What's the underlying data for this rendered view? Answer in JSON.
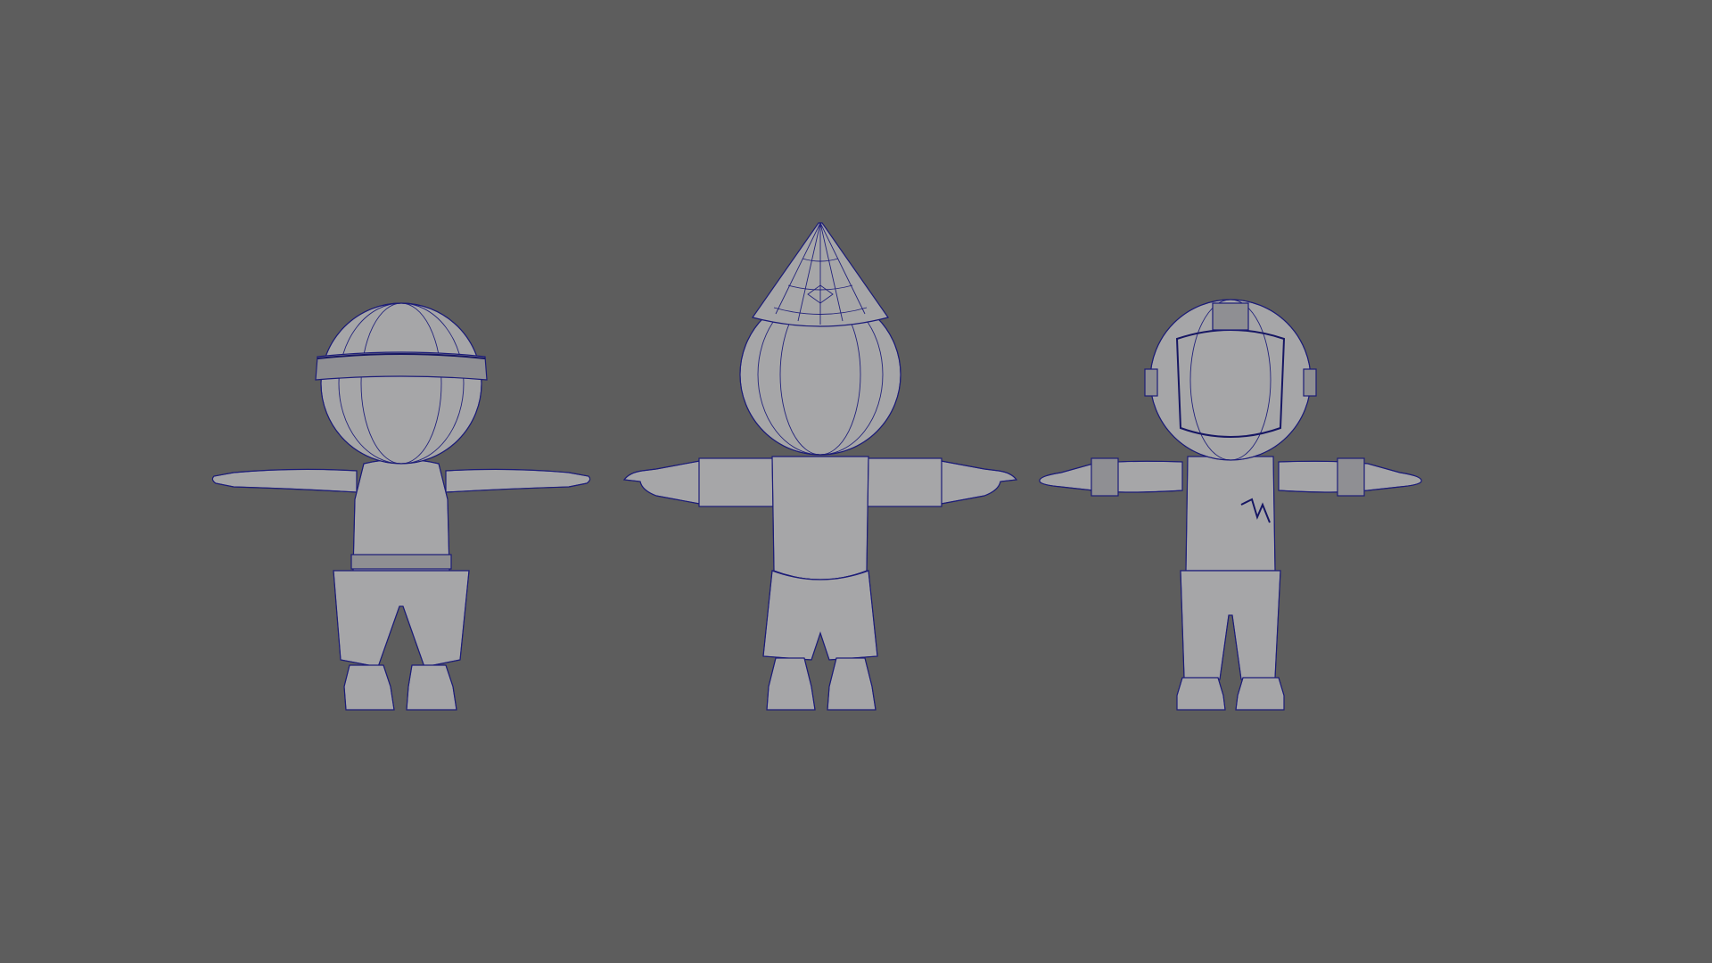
{
  "viewport": {
    "background_color": "#5d5d5d",
    "mesh_fill_color": "#a6a6a8",
    "wireframe_color": "#1c1c78"
  },
  "scene": {
    "models": [
      {
        "name": "character-headband",
        "accessory": "headband"
      },
      {
        "name": "character-cone-hat",
        "accessory": "cone-hat"
      },
      {
        "name": "character-helmet",
        "accessory": "helmet"
      }
    ]
  }
}
